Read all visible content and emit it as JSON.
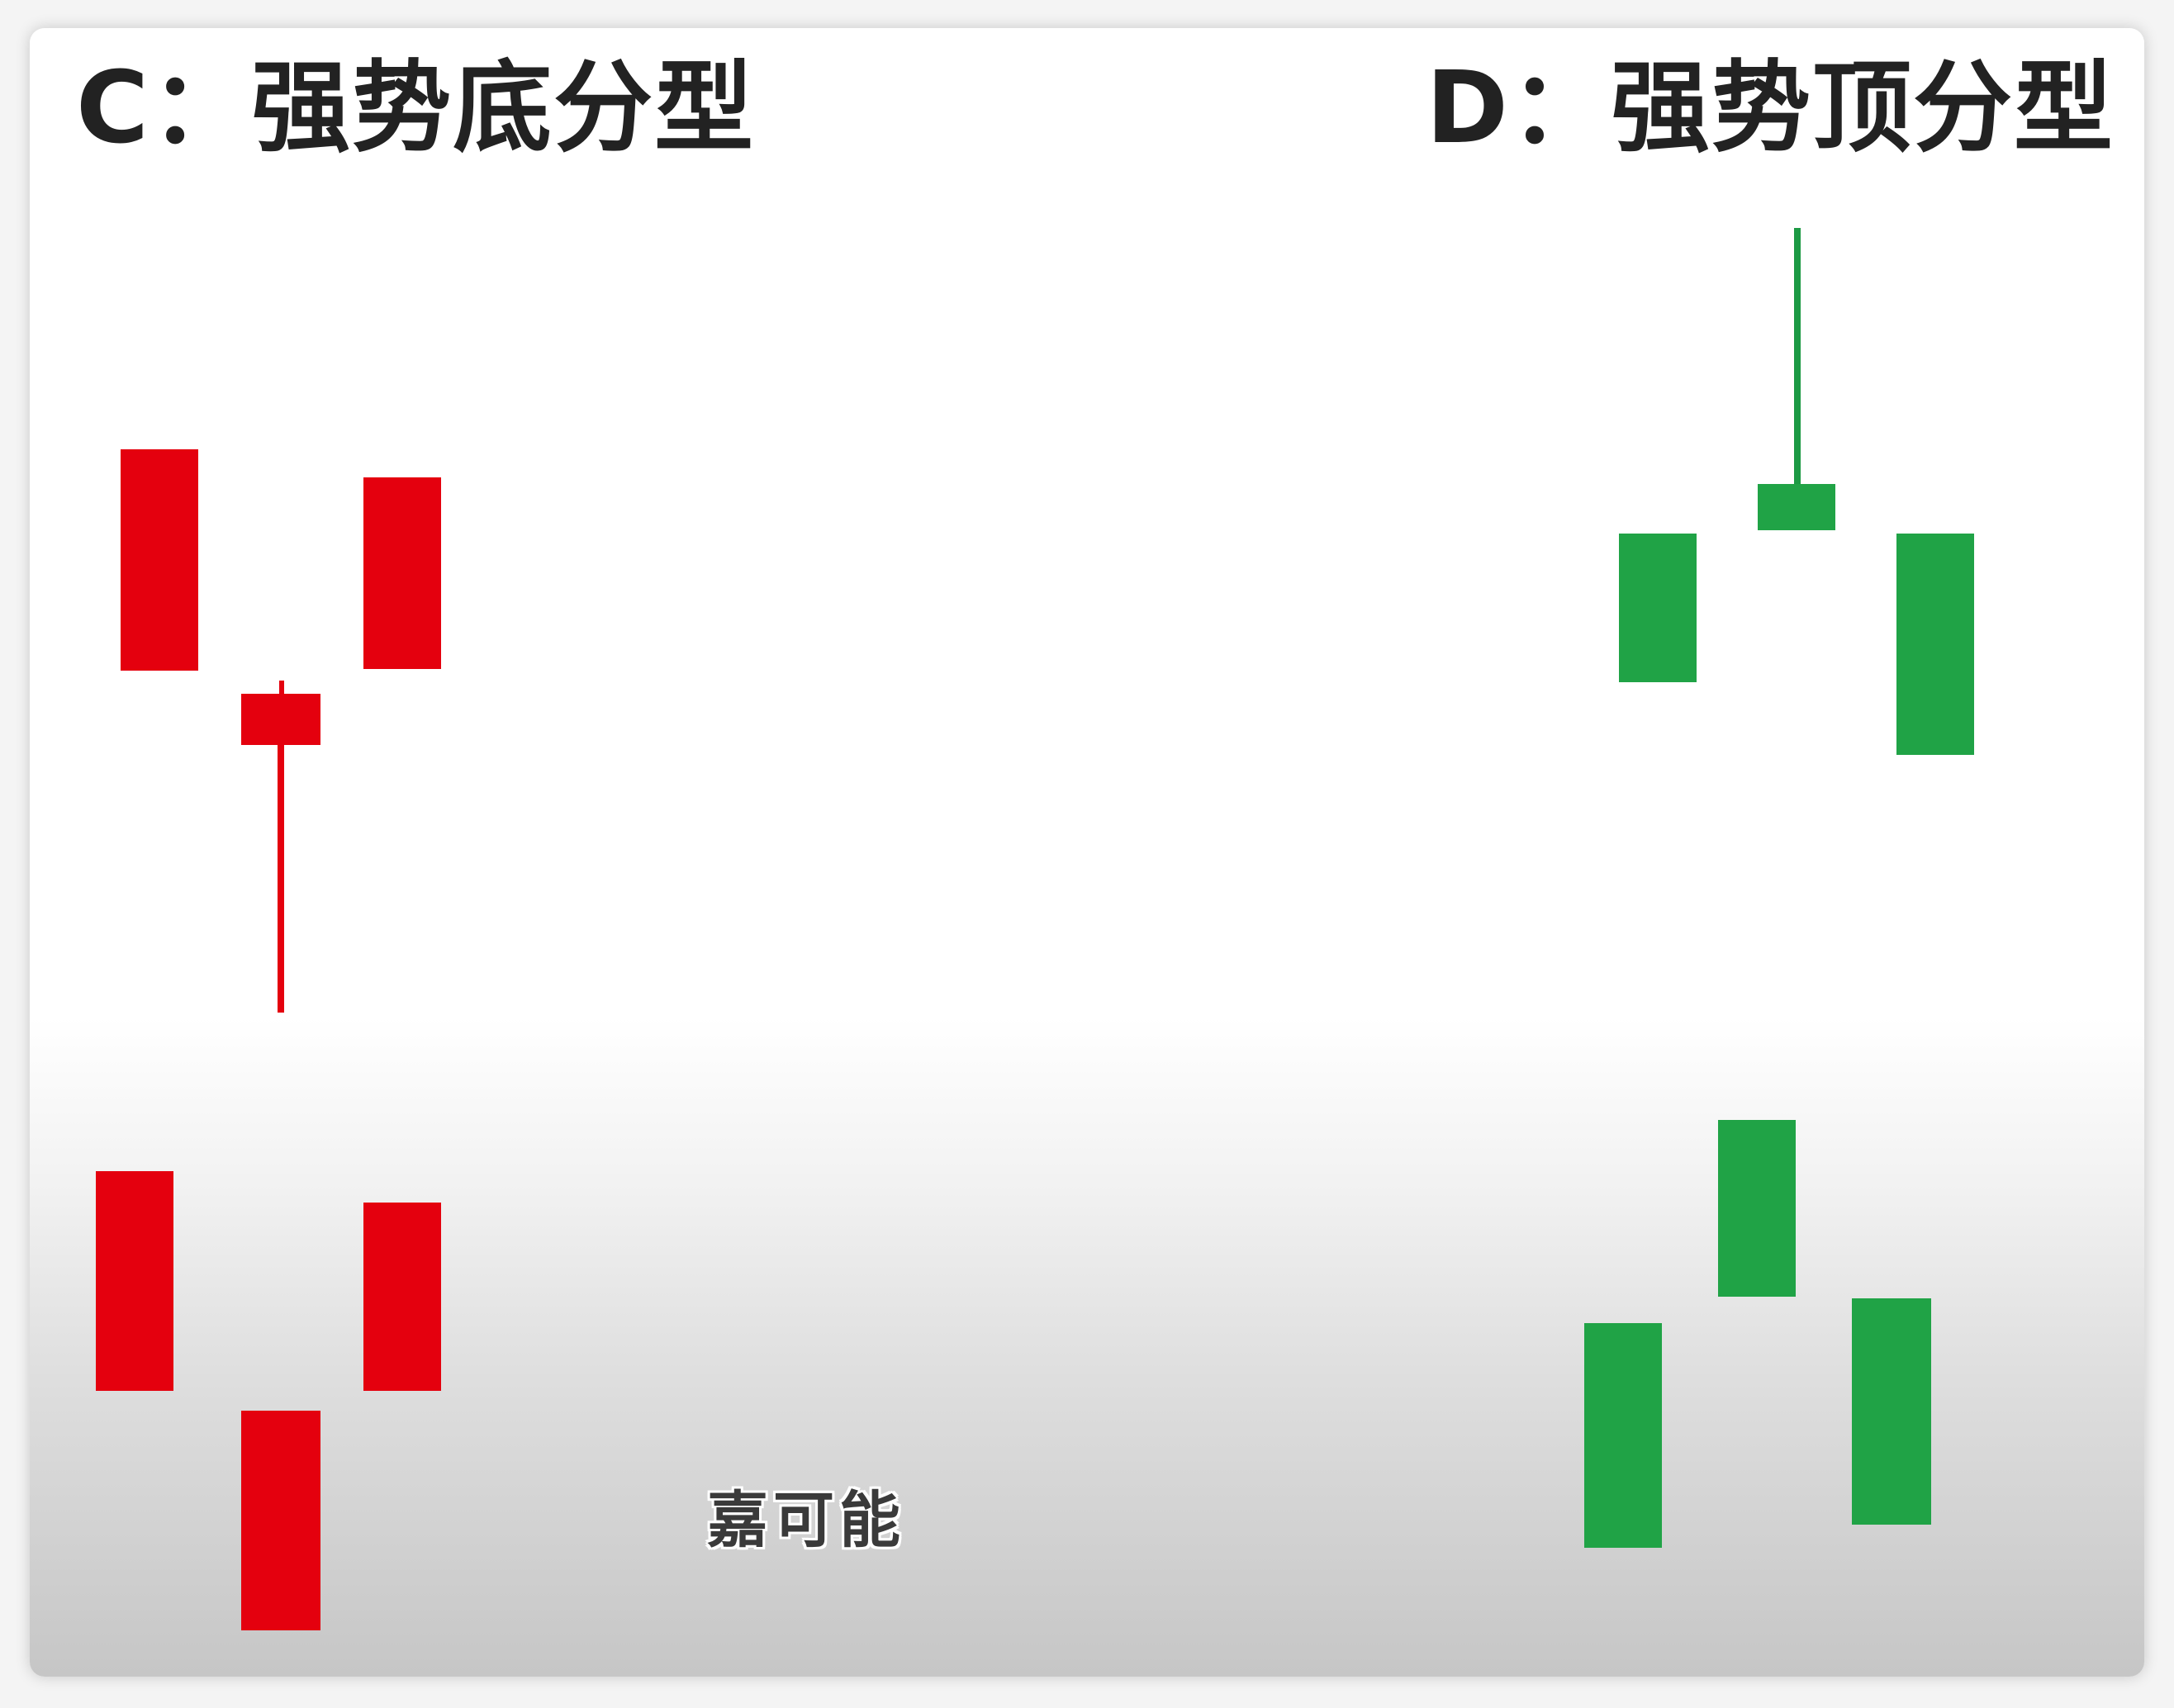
{
  "headings": {
    "left": "C：强势底分型",
    "right": "D：强势顶分型"
  },
  "subtitle": "嘉可能",
  "colors": {
    "bullish_red": "#e4000e",
    "bearish_green": "#20a346",
    "heading_text": "#222222"
  }
}
